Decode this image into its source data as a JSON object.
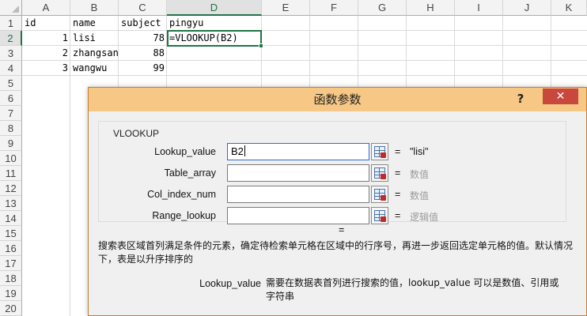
{
  "sheet": {
    "columns": [
      "A",
      "B",
      "C",
      "D",
      "E",
      "F",
      "G",
      "H",
      "I",
      "J",
      "K"
    ],
    "rows": [
      "1",
      "2",
      "3",
      "4",
      "5",
      "6",
      "7",
      "8",
      "9",
      "10",
      "11",
      "12",
      "13",
      "14",
      "15",
      "16",
      "17",
      "18",
      "19",
      "20"
    ],
    "selected_column": "D",
    "selected_row": "2",
    "cells": {
      "A1": "id",
      "B1": "name",
      "C1": "subject",
      "D1": "pingyu",
      "A2": "1",
      "B2": "lisi",
      "C2": "78",
      "D2": "=VLOOKUP(B2)",
      "A3": "2",
      "B3": "zhangsan",
      "C3": "88",
      "A4": "3",
      "B4": "wangwu",
      "C4": "99"
    }
  },
  "dialog": {
    "title": "函数参数",
    "help_label": "?",
    "close_label": "✕",
    "function_name": "VLOOKUP",
    "args": [
      {
        "label": "Lookup_value",
        "value": "B2",
        "eq": "=",
        "result": "\"lisi\"",
        "result_dim": false
      },
      {
        "label": "Table_array",
        "value": "",
        "eq": "=",
        "result": "数值",
        "result_dim": true
      },
      {
        "label": "Col_index_num",
        "value": "",
        "eq": "=",
        "result": "数值",
        "result_dim": true
      },
      {
        "label": "Range_lookup",
        "value": "",
        "eq": "=",
        "result": "逻辑值",
        "result_dim": true
      }
    ],
    "overall_eq": "=",
    "description": "搜索表区域首列满足条件的元素，确定待检索单元格在区域中的行序号，再进一步返回选定单元格的值。默认情况下，表是以升序排序的",
    "param_name": "Lookup_value",
    "param_description": "需要在数据表首列进行搜索的值，lookup_value 可以是数值、引用或字符串"
  },
  "colors": {
    "accent_green": "#217346",
    "dialog_title_bg": "#f7c885",
    "close_button_bg": "#c9483e",
    "dialog_bg": "#f0f0f0"
  }
}
